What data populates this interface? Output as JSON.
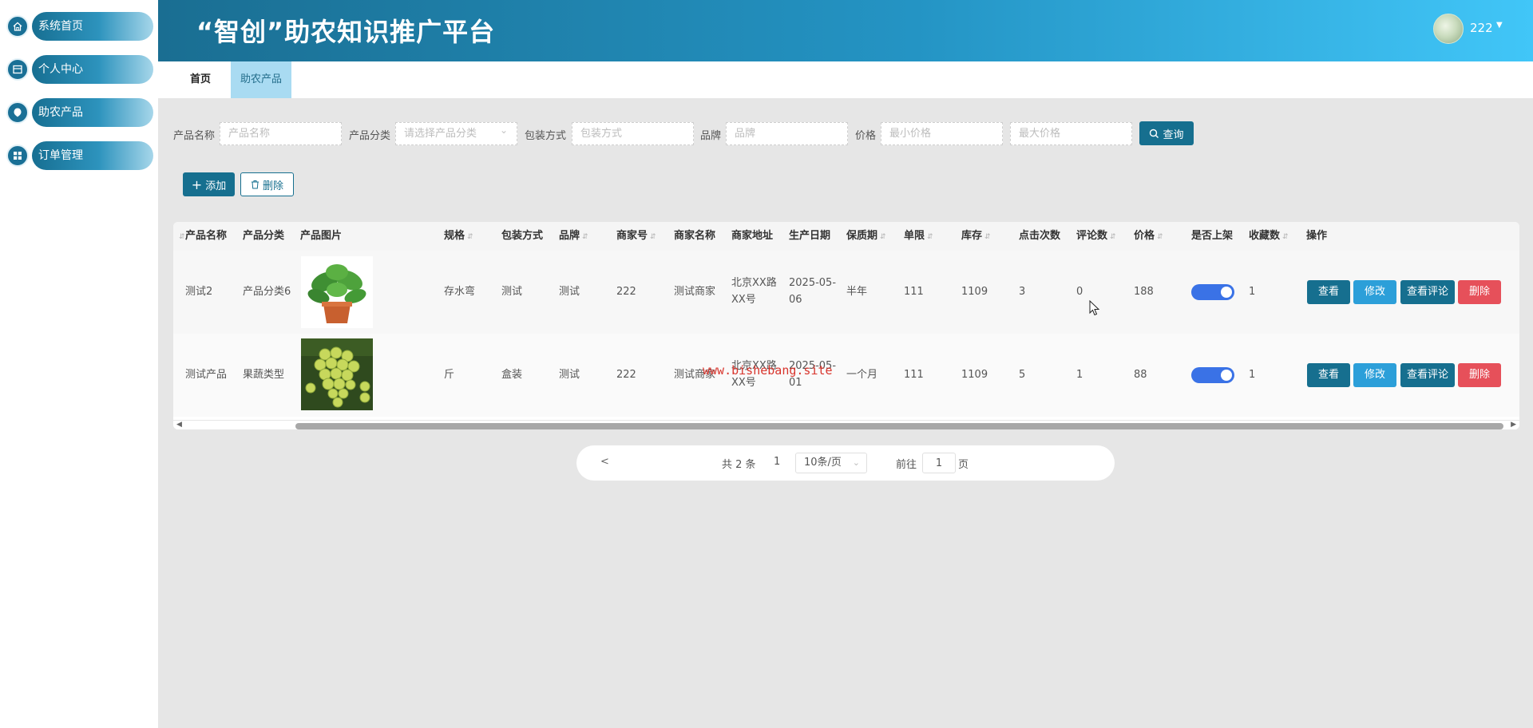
{
  "app": {
    "title": "“智创”助农知识推广平台",
    "user_name": "222"
  },
  "sidebar": {
    "items": [
      {
        "label": "系统首页",
        "icon": "home-icon"
      },
      {
        "label": "个人中心",
        "icon": "profile-icon"
      },
      {
        "label": "助农产品",
        "icon": "product-icon"
      },
      {
        "label": "订单管理",
        "icon": "grid-icon"
      }
    ]
  },
  "tabs": [
    {
      "label": "首页"
    },
    {
      "label": "助农产品"
    }
  ],
  "search": {
    "name_label": "产品名称",
    "name_placeholder": "产品名称",
    "category_label": "产品分类",
    "category_placeholder": "请选择产品分类",
    "pack_label": "包装方式",
    "pack_placeholder": "包装方式",
    "brand_label": "品牌",
    "brand_placeholder": "品牌",
    "price_label": "价格",
    "min_price_placeholder": "最小价格",
    "max_price_placeholder": "最大价格",
    "query_label": "查询"
  },
  "toolbar": {
    "add_label": "添加",
    "delete_label": "删除"
  },
  "table": {
    "headers": {
      "name": "产品名称",
      "category": "产品分类",
      "image": "产品图片",
      "spec": "规格",
      "pack": "包装方式",
      "brand": "品牌",
      "merchant_no": "商家号",
      "merchant_name": "商家名称",
      "merchant_addr": "商家地址",
      "prod_date": "生产日期",
      "shelf_life": "保质期",
      "limit": "单限",
      "stock": "库存",
      "clicks": "点击次数",
      "reviews": "评论数",
      "price": "价格",
      "on_sale": "是否上架",
      "favorites": "收藏数",
      "actions": "操作"
    },
    "rows": [
      {
        "name": "测试2",
        "category": "产品分类6",
        "image": "plant",
        "spec": "存水弯",
        "pack": "测试",
        "brand": "测试",
        "merchant_no": "222",
        "merchant_name": "测试商家",
        "merchant_addr_1": "北京XX路",
        "merchant_addr_2": "XX号",
        "prod_date_1": "2025-05-",
        "prod_date_2": "06",
        "shelf_life": "半年",
        "limit": "111",
        "stock": "1109",
        "clicks": "3",
        "reviews": "0",
        "price": "188",
        "on_sale": true,
        "favorites": "1"
      },
      {
        "name": "测试产品",
        "category": "果蔬类型",
        "image": "grapes",
        "spec": "斤",
        "pack": "盒装",
        "brand": "测试",
        "merchant_no": "222",
        "merchant_name": "测试商家",
        "merchant_addr_1": "北京XX路",
        "merchant_addr_2": "XX号",
        "prod_date_1": "2025-05-",
        "prod_date_2": "01",
        "shelf_life": "一个月",
        "limit": "111",
        "stock": "1109",
        "clicks": "5",
        "reviews": "1",
        "price": "88",
        "on_sale": true,
        "favorites": "1"
      }
    ],
    "actions": {
      "view": "查看",
      "edit": "修改",
      "view_reviews": "查看评论",
      "delete": "删除"
    }
  },
  "pagination": {
    "prev": "<",
    "total": "共 2 条",
    "current": "1",
    "page_size": "10条/页",
    "goto_label": "前往",
    "goto_value": "1",
    "page_unit": "页"
  },
  "watermark": "www.bishebang.site"
}
